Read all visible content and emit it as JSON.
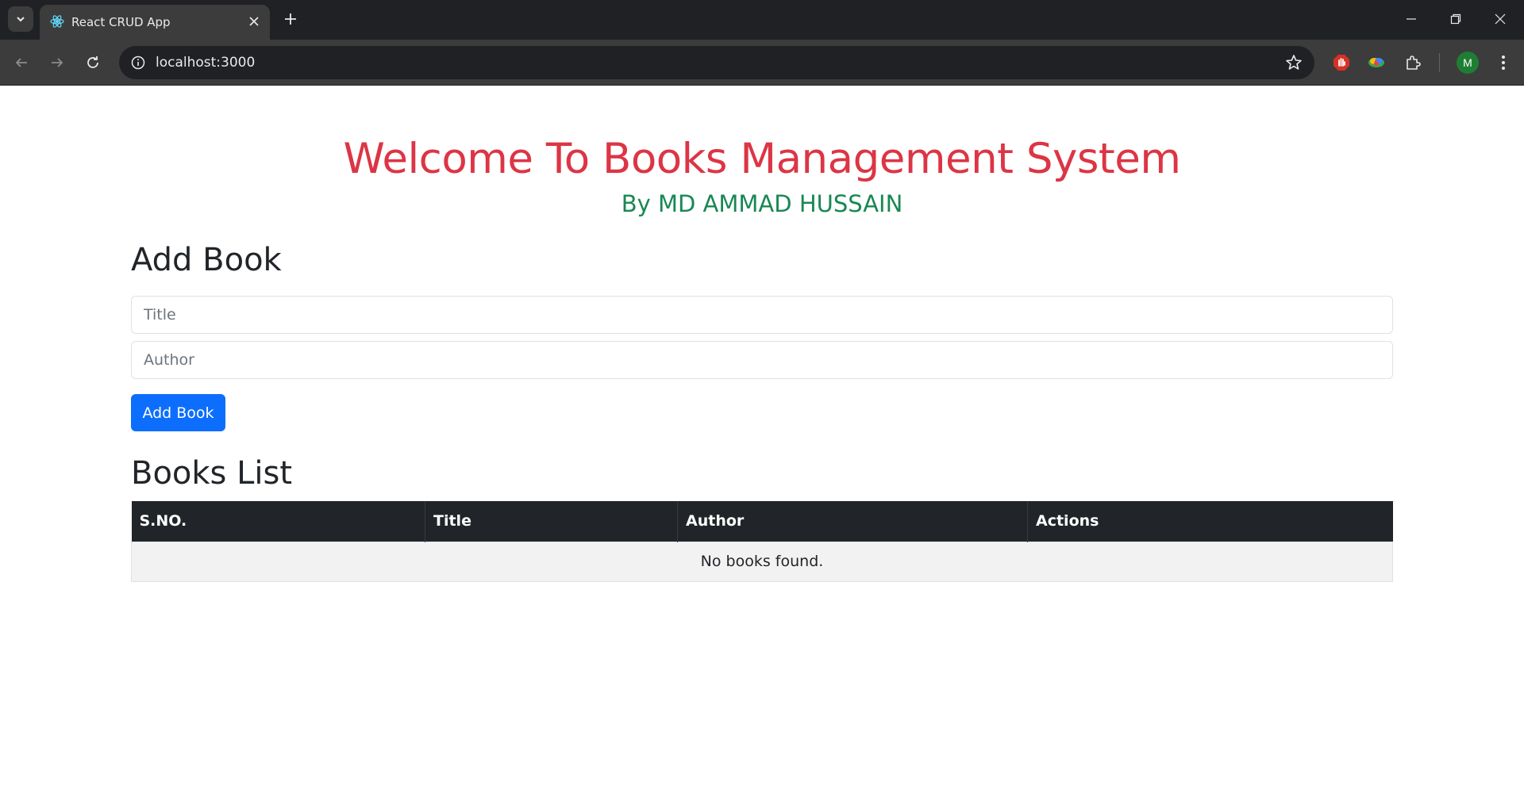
{
  "browser": {
    "tab_title": "React CRUD App",
    "url": "localhost:3000",
    "profile_initial": "M",
    "icons": [
      "tab-list-icon",
      "react-favicon-icon",
      "close-icon",
      "plus-icon",
      "minimize-icon",
      "restore-icon",
      "close-window-icon",
      "back-icon",
      "forward-icon",
      "reload-icon",
      "site-info-icon",
      "star-icon",
      "adblock-extension-icon",
      "extension-icon",
      "puzzle-icon",
      "kebab-menu-icon"
    ]
  },
  "header": {
    "title": "Welcome To Books Management System",
    "subtitle": "By MD AMMAD HUSSAIN",
    "title_color": "#dc3545",
    "subtitle_color": "#198754"
  },
  "add_form": {
    "heading": "Add Book",
    "title_placeholder": "Title",
    "author_placeholder": "Author",
    "title_value": "",
    "author_value": "",
    "submit_label": "Add Book",
    "button_color": "#0d6efd"
  },
  "books_list": {
    "heading": "Books List",
    "columns": [
      "S.NO.",
      "Title",
      "Author",
      "Actions"
    ],
    "empty_message": "No books found."
  }
}
